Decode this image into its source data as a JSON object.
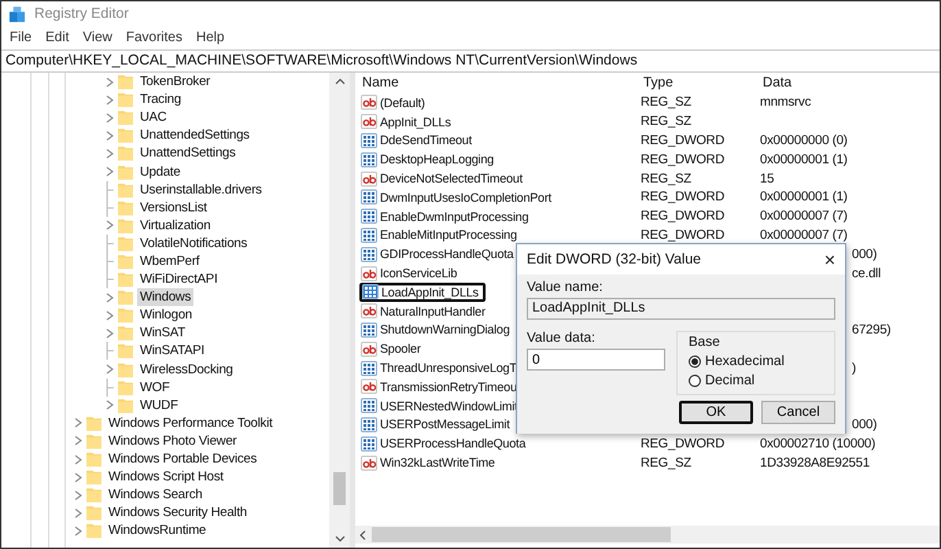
{
  "window": {
    "title": "Registry Editor"
  },
  "menu": [
    "File",
    "Edit",
    "View",
    "Favorites",
    "Help"
  ],
  "address": "Computer\\HKEY_LOCAL_MACHINE\\SOFTWARE\\Microsoft\\Windows NT\\CurrentVersion\\Windows",
  "tree": {
    "items": [
      {
        "children": [
          {
            "label": "TokenBroker",
            "expandable": true,
            "selected": false
          },
          {
            "label": "Tracing",
            "expandable": true,
            "selected": false
          },
          {
            "label": "UAC",
            "expandable": true,
            "selected": false
          },
          {
            "label": "UnattendedSettings",
            "expandable": true,
            "selected": false
          },
          {
            "label": "UnattendSettings",
            "expandable": true,
            "selected": false
          },
          {
            "label": "Update",
            "expandable": true,
            "selected": false
          },
          {
            "label": "Userinstallable.drivers",
            "expandable": false,
            "selected": false
          },
          {
            "label": "VersionsList",
            "expandable": false,
            "selected": false
          },
          {
            "label": "Virtualization",
            "expandable": true,
            "selected": false
          },
          {
            "label": "VolatileNotifications",
            "expandable": false,
            "selected": false
          },
          {
            "label": "WbemPerf",
            "expandable": false,
            "selected": false
          },
          {
            "label": "WiFiDirectAPI",
            "expandable": false,
            "selected": false
          },
          {
            "label": "Windows",
            "expandable": true,
            "selected": true
          },
          {
            "label": "Winlogon",
            "expandable": true,
            "selected": false
          },
          {
            "label": "WinSAT",
            "expandable": true,
            "selected": false
          },
          {
            "label": "WinSATAPI",
            "expandable": false,
            "selected": false
          },
          {
            "label": "WirelessDocking",
            "expandable": true,
            "selected": false
          },
          {
            "label": "WOF",
            "expandable": false,
            "selected": false
          },
          {
            "label": "WUDF",
            "expandable": true,
            "selected": false
          }
        ]
      },
      {
        "label": "Windows Performance Toolkit",
        "expandable": true,
        "selected": false
      },
      {
        "label": "Windows Photo Viewer",
        "expandable": true,
        "selected": false
      },
      {
        "label": "Windows Portable Devices",
        "expandable": true,
        "selected": false
      },
      {
        "label": "Windows Script Host",
        "expandable": true,
        "selected": false
      },
      {
        "label": "Windows Search",
        "expandable": true,
        "selected": false
      },
      {
        "label": "Windows Security Health",
        "expandable": true,
        "selected": false
      },
      {
        "label": "WindowsRuntime",
        "expandable": true,
        "selected": false
      }
    ]
  },
  "values": {
    "columns": [
      "Name",
      "Type",
      "Data"
    ],
    "rows": [
      {
        "kind": "sz",
        "name": "(Default)",
        "type": "REG_SZ",
        "data": "mnmsrvc",
        "covered": false,
        "selected": false,
        "outlined": false
      },
      {
        "kind": "sz",
        "name": "AppInit_DLLs",
        "type": "REG_SZ",
        "covered": false,
        "selected": false,
        "outlined": false
      },
      {
        "kind": "dword",
        "name": "DdeSendTimeout",
        "type": "REG_DWORD",
        "data": "0x00000000 (0)",
        "covered": false,
        "selected": false,
        "outlined": false
      },
      {
        "kind": "dword",
        "name": "DesktopHeapLogging",
        "type": "REG_DWORD",
        "data": "0x00000001 (1)",
        "covered": false,
        "selected": false,
        "outlined": false
      },
      {
        "kind": "sz",
        "name": "DeviceNotSelectedTimeout",
        "type": "REG_SZ",
        "data": "15",
        "covered": false,
        "selected": false,
        "outlined": false
      },
      {
        "kind": "dword",
        "name": "DwmInputUsesIoCompletionPort",
        "type": "REG_DWORD",
        "data": "0x00000001 (1)",
        "covered": false,
        "selected": false,
        "outlined": false
      },
      {
        "kind": "dword",
        "name": "EnableDwmInputProcessing",
        "type": "REG_DWORD",
        "data": "0x00000007 (7)",
        "covered": false,
        "selected": false,
        "outlined": false
      },
      {
        "kind": "dword",
        "name": "EnableMitInputProcessing",
        "type": "REG_DWORD",
        "data": "0x00000007 (7)",
        "covered": false,
        "selected": false,
        "outlined": false
      },
      {
        "kind": "dword",
        "name": "GDIProcessHandleQuota",
        "data": "000)",
        "covered": true,
        "selected": false,
        "outlined": false
      },
      {
        "kind": "sz",
        "name": "IconServiceLib",
        "data": "ce.dll",
        "covered": true,
        "selected": false,
        "outlined": false
      },
      {
        "kind": "dword",
        "name": "LoadAppInit_DLLs",
        "covered": true,
        "selected": true,
        "outlined": true
      },
      {
        "kind": "sz",
        "name": "NaturalInputHandler",
        "covered": true,
        "selected": false,
        "outlined": false
      },
      {
        "kind": "dword",
        "name": "ShutdownWarningDialog",
        "data": "67295)",
        "covered": true,
        "selected": false,
        "outlined": false
      },
      {
        "kind": "sz",
        "name": "Spooler",
        "covered": true,
        "selected": false,
        "outlined": false
      },
      {
        "kind": "dword",
        "name": "ThreadUnresponsiveLogT",
        "data": ")",
        "covered": true,
        "selected": false,
        "outlined": false
      },
      {
        "kind": "sz",
        "name": "TransmissionRetryTimeou",
        "covered": true,
        "selected": false,
        "outlined": false
      },
      {
        "kind": "dword",
        "name": "USERNestedWindowLimit",
        "covered": true,
        "selected": false,
        "outlined": false
      },
      {
        "kind": "dword",
        "name": "USERPostMessageLimit",
        "data": "000)",
        "covered": true,
        "selected": false,
        "outlined": false
      },
      {
        "kind": "dword",
        "name": "USERProcessHandleQuota",
        "type": "REG_DWORD",
        "data": "0x00002710 (10000)",
        "covered": false,
        "selected": false,
        "outlined": false
      },
      {
        "kind": "sz",
        "name": "Win32kLastWriteTime",
        "type": "REG_SZ",
        "data": "1D33928A8E92551",
        "covered": false,
        "selected": false,
        "outlined": false
      }
    ]
  },
  "dialog": {
    "title": "Edit DWORD (32-bit) Value",
    "close": "×",
    "value_name_label": "Value name:",
    "value_name": "LoadAppInit_DLLs",
    "value_data_label": "Value data:",
    "value_data": "0",
    "base_label": "Base",
    "bases": [
      {
        "label": "Hexadecimal",
        "selected": true
      },
      {
        "label": "Decimal",
        "selected": false
      }
    ],
    "buttons": [
      {
        "label": "OK",
        "outlined": true
      },
      {
        "label": "Cancel",
        "outlined": false
      }
    ]
  }
}
